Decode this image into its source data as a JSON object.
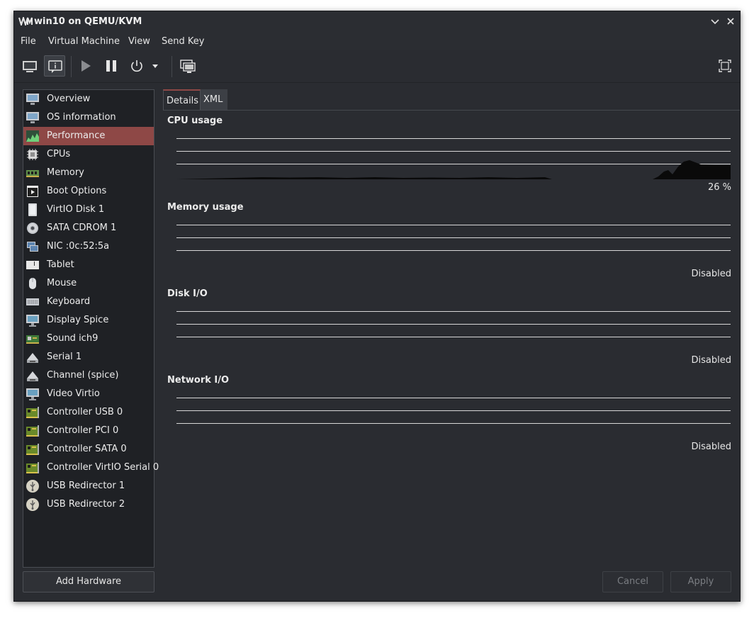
{
  "window": {
    "title": "win10 on QEMU/KVM"
  },
  "menubar": {
    "items": [
      "File",
      "Virtual Machine",
      "View",
      "Send Key"
    ]
  },
  "sidebar": {
    "items": [
      {
        "label": "Overview",
        "icon": "monitor-icon"
      },
      {
        "label": "OS information",
        "icon": "monitor-icon"
      },
      {
        "label": "Performance",
        "icon": "performance-graph-icon"
      },
      {
        "label": "CPUs",
        "icon": "cpu-chip-icon"
      },
      {
        "label": "Memory",
        "icon": "memory-module-icon"
      },
      {
        "label": "Boot Options",
        "icon": "boot-window-icon"
      },
      {
        "label": "VirtIO Disk 1",
        "icon": "hard-disk-icon"
      },
      {
        "label": "SATA CDROM 1",
        "icon": "cdrom-icon"
      },
      {
        "label": "NIC :0c:52:5a",
        "icon": "network-card-icon"
      },
      {
        "label": "Tablet",
        "icon": "tablet-icon"
      },
      {
        "label": "Mouse",
        "icon": "mouse-icon"
      },
      {
        "label": "Keyboard",
        "icon": "keyboard-icon"
      },
      {
        "label": "Display Spice",
        "icon": "display-icon"
      },
      {
        "label": "Sound ich9",
        "icon": "sound-card-icon"
      },
      {
        "label": "Serial 1",
        "icon": "serial-port-icon"
      },
      {
        "label": "Channel (spice)",
        "icon": "serial-port-icon"
      },
      {
        "label": "Video Virtio",
        "icon": "display-icon"
      },
      {
        "label": "Controller USB 0",
        "icon": "controller-card-icon"
      },
      {
        "label": "Controller PCI 0",
        "icon": "controller-card-icon"
      },
      {
        "label": "Controller SATA 0",
        "icon": "controller-card-icon"
      },
      {
        "label": "Controller VirtIO Serial 0",
        "icon": "controller-card-icon"
      },
      {
        "label": "USB Redirector 1",
        "icon": "usb-icon"
      },
      {
        "label": "USB Redirector 2",
        "icon": "usb-icon"
      }
    ],
    "selected_index": 2,
    "add_hardware_label": "Add Hardware"
  },
  "tabs": [
    {
      "label": "Details",
      "active": true
    },
    {
      "label": "XML",
      "active": false
    }
  ],
  "performance": {
    "cpu": {
      "title": "CPU usage",
      "value": "26 %"
    },
    "memory": {
      "title": "Memory usage",
      "value": "Disabled"
    },
    "disk": {
      "title": "Disk I/O",
      "value": "Disabled"
    },
    "network": {
      "title": "Network I/O",
      "value": "Disabled"
    }
  },
  "buttons": {
    "cancel": "Cancel",
    "apply": "Apply"
  },
  "colors": {
    "selection": "#8e4846",
    "background": "#2a2c31",
    "list_background": "#1f2125"
  }
}
